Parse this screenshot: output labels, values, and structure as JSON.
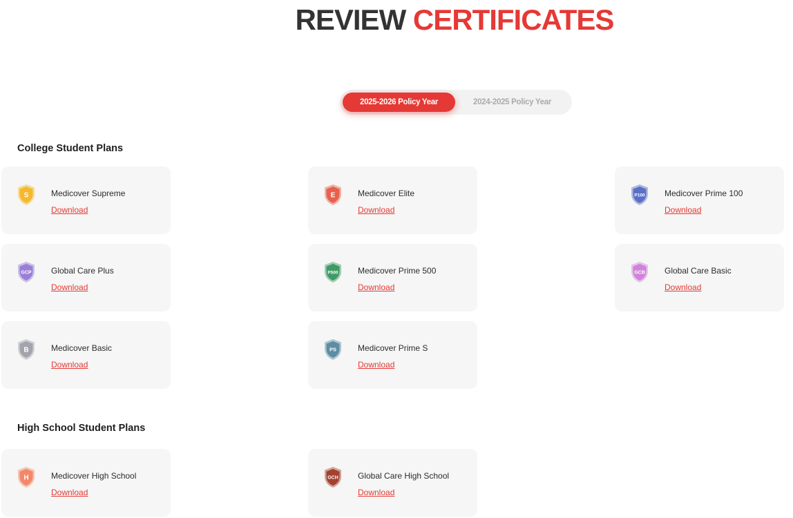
{
  "header": {
    "title_dark": "REVIEW",
    "title_accent": "CERTIFICATES"
  },
  "policy_years": {
    "active": "2025-2026 Policy Year",
    "inactive": "2024-2025 Policy Year"
  },
  "colors": {
    "accent": "#e53935",
    "card_bg": "#f5f6f5"
  },
  "sections": [
    {
      "heading": "College Student Plans",
      "plans": [
        {
          "name": "Medicover Supreme",
          "badge": "S",
          "icon": "shield-icon",
          "color": "#f5b82e",
          "link": "Download"
        },
        {
          "name": "Medicover Elite",
          "badge": "E",
          "icon": "shield-icon",
          "color": "#e8604c",
          "link": "Download"
        },
        {
          "name": "Medicover Prime 100",
          "badge": "P100",
          "icon": "shield-icon",
          "color": "#5c6fc7",
          "link": "Download"
        },
        {
          "name": "Global Care Plus",
          "badge": "GCP",
          "icon": "shield-icon",
          "color": "#9a7fd6",
          "link": "Download"
        },
        {
          "name": "Medicover Prime 500",
          "badge": "P500",
          "icon": "shield-icon",
          "color": "#3f9a66",
          "link": "Download"
        },
        {
          "name": "Global Care Basic",
          "badge": "GCB",
          "icon": "shield-icon",
          "color": "#d182d9",
          "link": "Download"
        },
        {
          "name": "Medicover Basic",
          "badge": "B",
          "icon": "shield-icon",
          "color": "#a3a3ad",
          "link": "Download"
        },
        {
          "name": "Medicover Prime S",
          "badge": "PS",
          "icon": "shield-icon",
          "color": "#5d8da3",
          "link": "Download"
        }
      ]
    },
    {
      "heading": "High School Student Plans",
      "plans": [
        {
          "name": "Medicover High School",
          "badge": "H",
          "icon": "shield-icon",
          "color": "#f2876a",
          "link": "Download"
        },
        {
          "name": "Global Care High School",
          "badge": "GCH",
          "icon": "shield-icon",
          "color": "#a3402e",
          "link": "Download"
        }
      ]
    }
  ]
}
